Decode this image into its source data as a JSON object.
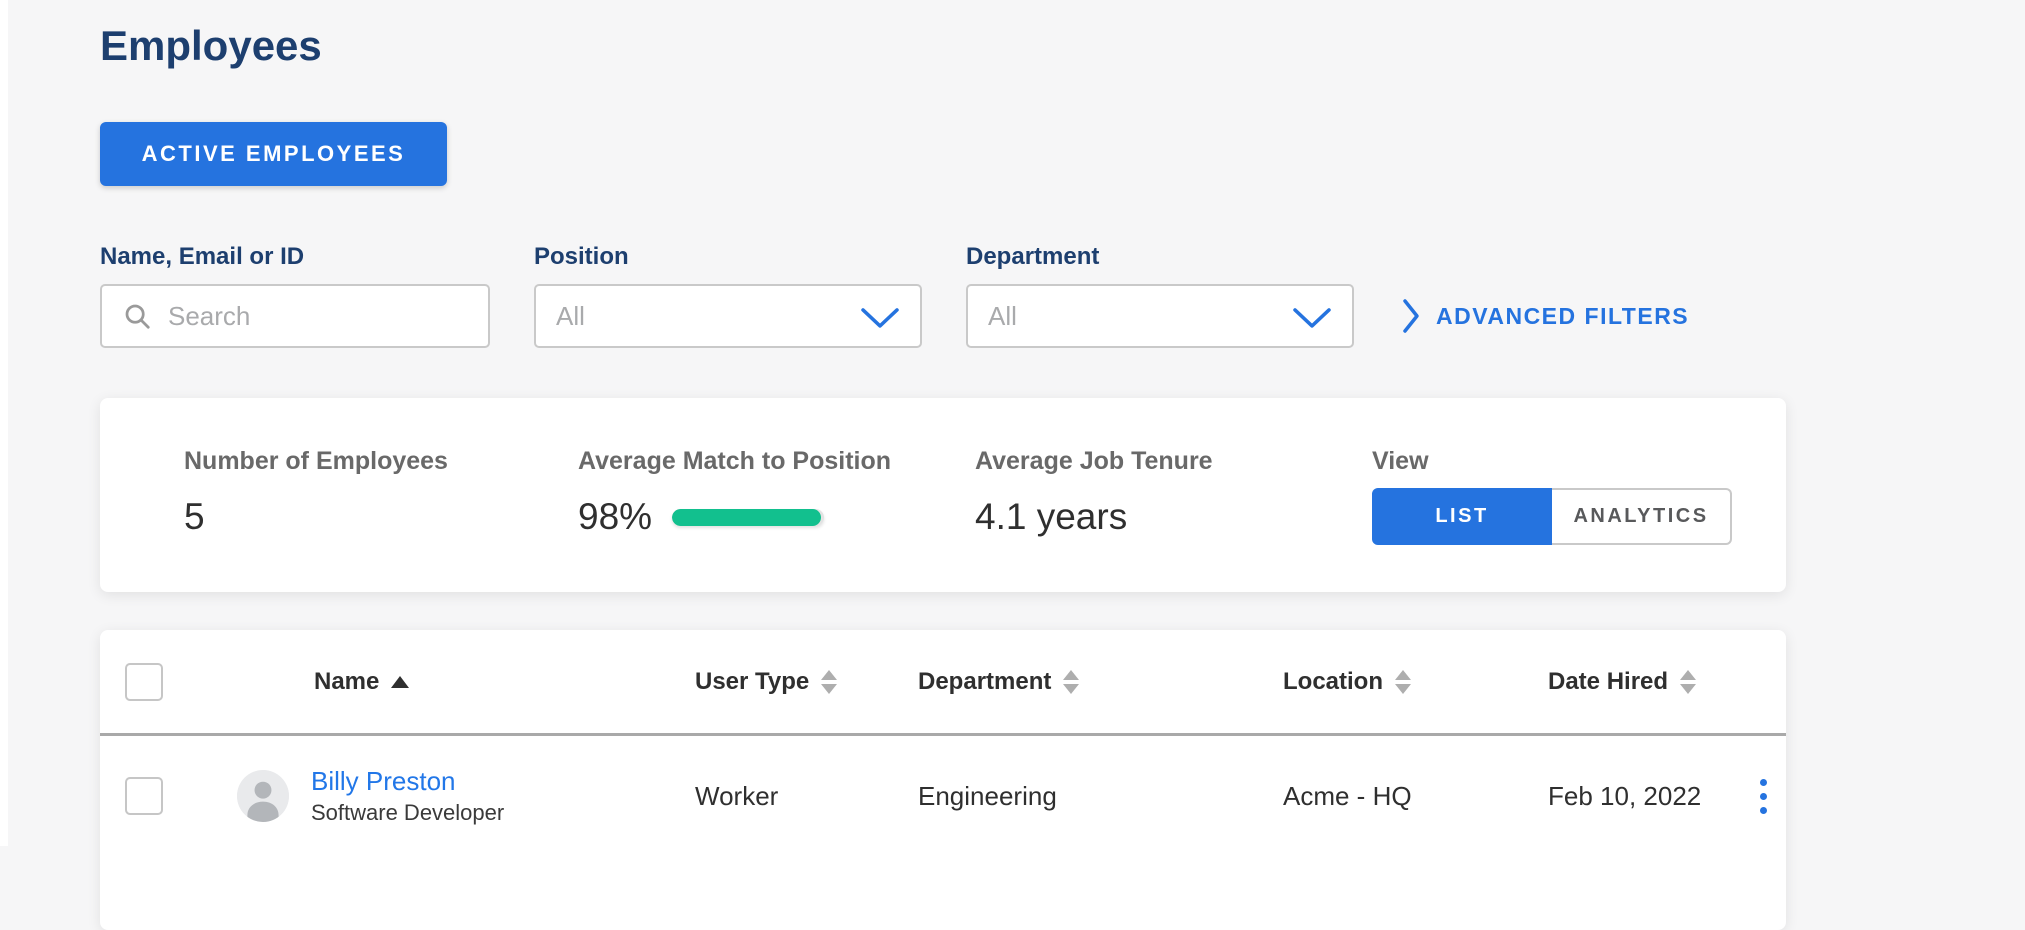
{
  "page": {
    "title": "Employees"
  },
  "toolbar": {
    "active_employees_label": "ACTIVE EMPLOYEES"
  },
  "filters": {
    "search": {
      "label": "Name, Email or ID",
      "placeholder": "Search",
      "value": ""
    },
    "position": {
      "label": "Position",
      "value": "All"
    },
    "department": {
      "label": "Department",
      "value": "All"
    },
    "advanced_label": "ADVANCED FILTERS"
  },
  "stats": {
    "employees": {
      "label": "Number of Employees",
      "value": "5"
    },
    "match": {
      "label": "Average Match to Position",
      "value": "98%",
      "percent": 98
    },
    "tenure": {
      "label": "Average Job Tenure",
      "value": "4.1 years"
    },
    "view": {
      "label": "View",
      "options": [
        {
          "label": "LIST",
          "active": true
        },
        {
          "label": "ANALYTICS",
          "active": false
        }
      ]
    }
  },
  "table": {
    "columns": [
      {
        "label": "Name",
        "sort": "asc"
      },
      {
        "label": "User Type",
        "sort": "none"
      },
      {
        "label": "Department",
        "sort": "none"
      },
      {
        "label": "Location",
        "sort": "none"
      },
      {
        "label": "Date Hired",
        "sort": "none"
      }
    ],
    "rows": [
      {
        "name": "Billy Preston",
        "title": "Software Developer",
        "user_type": "Worker",
        "department": "Engineering",
        "location": "Acme - HQ",
        "date_hired": "Feb 10, 2022"
      }
    ]
  },
  "colors": {
    "accent_blue": "#2573df",
    "navy": "#1d3f6f",
    "link_blue": "#2277e8",
    "progress_green": "#12c08e",
    "background": "#f6f6f7"
  }
}
